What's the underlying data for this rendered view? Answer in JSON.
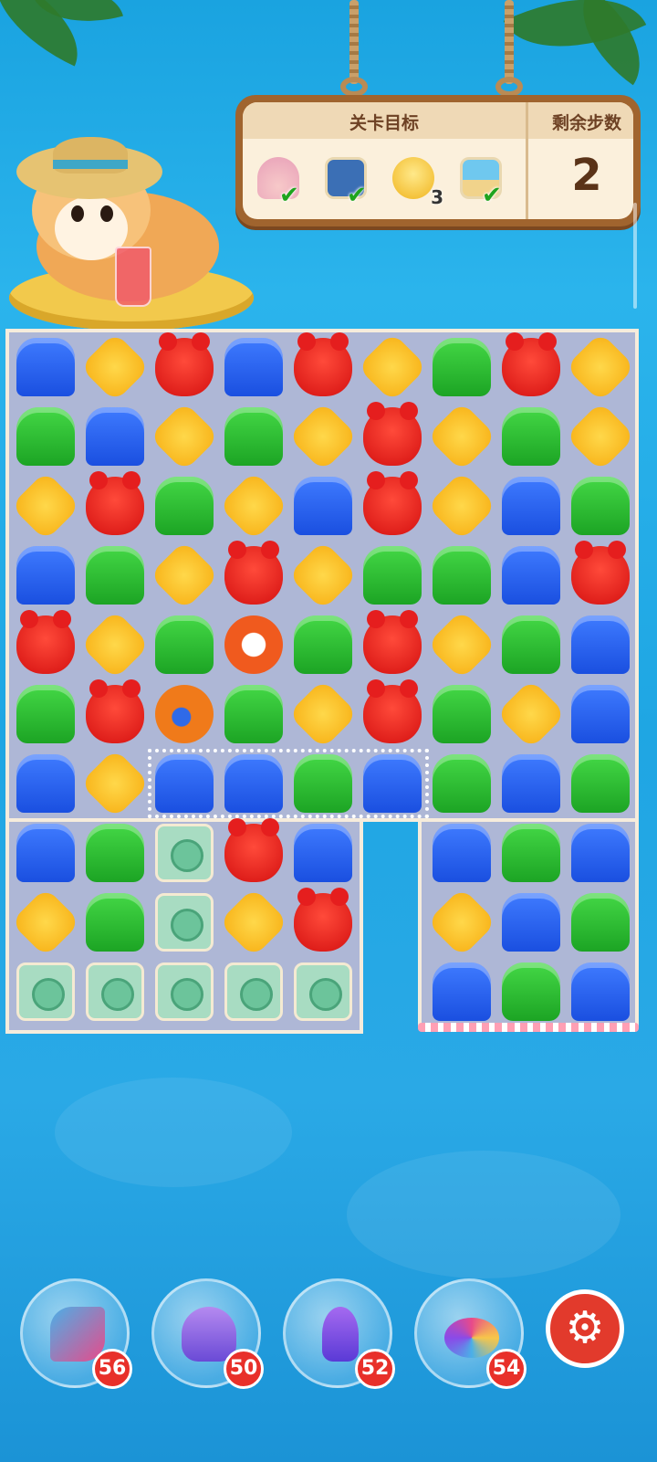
{
  "goals_panel": {
    "goal_title": "关卡目标",
    "moves_title": "剩余步数",
    "moves_remaining": "2",
    "goals": [
      {
        "icon": "shell-icon",
        "completed": true
      },
      {
        "icon": "sailor-portrait-icon",
        "completed": true
      },
      {
        "icon": "lightbulb-icon",
        "completed": false,
        "count": "3"
      },
      {
        "icon": "palm-beach-icon",
        "completed": true
      }
    ]
  },
  "board": {
    "rows": [
      [
        "blue",
        "yellow",
        "red",
        "blue",
        "red",
        "yellow",
        "green",
        "red",
        "yellow"
      ],
      [
        "green",
        "blue",
        "yellow",
        "green",
        "yellow",
        "red",
        "yellow",
        "green",
        "yellow"
      ],
      [
        "yellow",
        "red",
        "green",
        "yellow",
        "blue",
        "red",
        "yellow",
        "blue",
        "green"
      ],
      [
        "blue",
        "green",
        "yellow",
        "red",
        "yellow",
        "green",
        "green",
        "blue",
        "red"
      ],
      [
        "red",
        "yellow",
        "green",
        "special",
        "green",
        "red",
        "yellow",
        "green",
        "blue"
      ],
      [
        "green",
        "red",
        "heli",
        "green",
        "yellow",
        "red",
        "green",
        "yellow",
        "blue"
      ],
      [
        "blue",
        "yellow",
        "blue",
        "blue",
        "green",
        "blue",
        "green",
        "blue",
        "green"
      ],
      [
        "blue",
        "green",
        "camera",
        "red",
        "blue",
        "",
        "blue",
        "green",
        "blue"
      ],
      [
        "yellow",
        "green",
        "camera",
        "yellow",
        "red",
        "",
        "yellow",
        "blue",
        "green"
      ],
      [
        "camera",
        "camera",
        "camera",
        "camera",
        "camera",
        "",
        "blue",
        "green",
        "blue"
      ]
    ]
  },
  "boosters": [
    {
      "name": "hammer",
      "count": "56"
    },
    {
      "name": "plane",
      "count": "50"
    },
    {
      "name": "rocket",
      "count": "52"
    },
    {
      "name": "spinning-top",
      "count": "54"
    }
  ],
  "colors": {
    "accent_red": "#e23a2c",
    "panel_brown": "#a0642e",
    "panel_cream": "#fbf0dc"
  }
}
